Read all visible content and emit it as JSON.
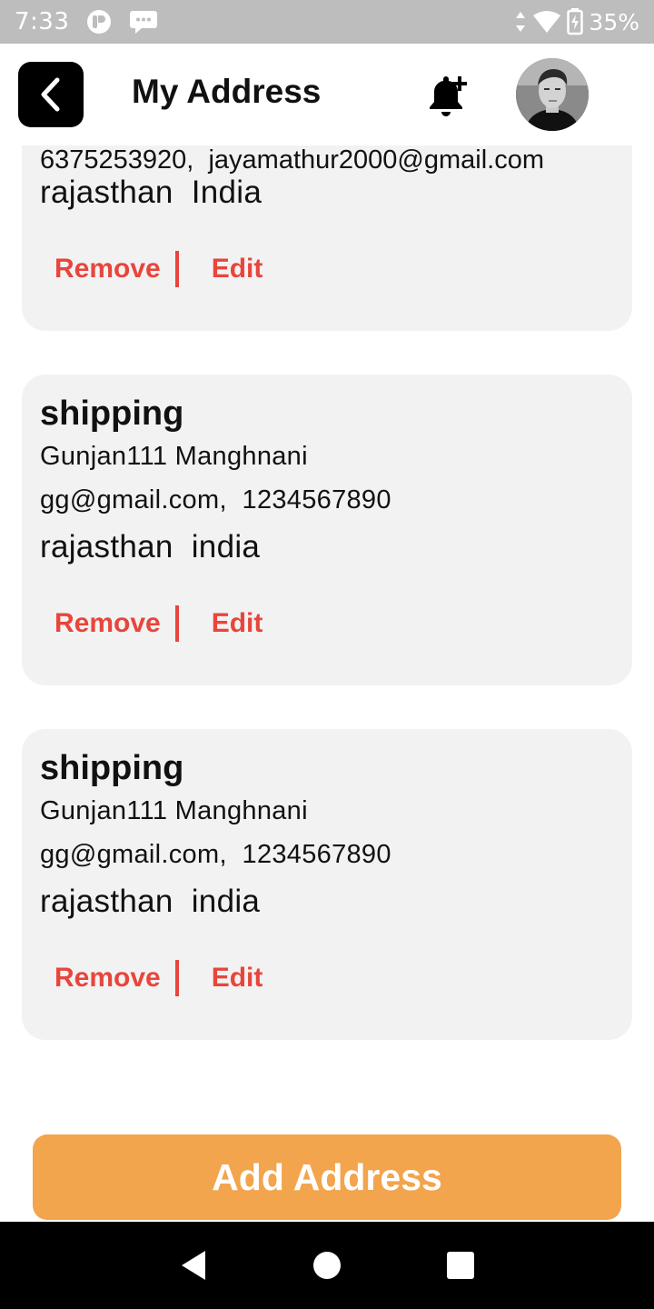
{
  "status_bar": {
    "time": "7:33",
    "battery": "35%",
    "icons": [
      "app-notification-icon",
      "chat-notification-icon",
      "data-arrows-icon",
      "wifi-icon",
      "battery-charging-icon"
    ]
  },
  "header": {
    "title": "My Address",
    "icons": [
      "back-arrow-icon",
      "bell-plus-icon",
      "avatar-photo"
    ]
  },
  "addresses": [
    {
      "contact_partial": "6375253920,  jayamathur2000@gmail.com",
      "region": "rajasthan  India",
      "remove_label": "Remove",
      "edit_label": "Edit"
    },
    {
      "type": "shipping",
      "name": "Gunjan111 Manghnani",
      "contact": "gg@gmail.com,  1234567890",
      "region": "rajasthan  india",
      "remove_label": "Remove",
      "edit_label": "Edit"
    },
    {
      "type": "shipping",
      "name": "Gunjan111 Manghnani",
      "contact": "gg@gmail.com,  1234567890",
      "region": "rajasthan  india",
      "remove_label": "Remove",
      "edit_label": "Edit"
    }
  ],
  "add_button": {
    "label": "Add Address"
  },
  "colors": {
    "accent": "#e8453c",
    "button": "#f2a54c",
    "card": "#f2f2f2",
    "status_bar": "#bdbdbd"
  },
  "nav": {
    "icons": [
      "nav-back-icon",
      "nav-home-icon",
      "nav-recents-icon"
    ]
  }
}
